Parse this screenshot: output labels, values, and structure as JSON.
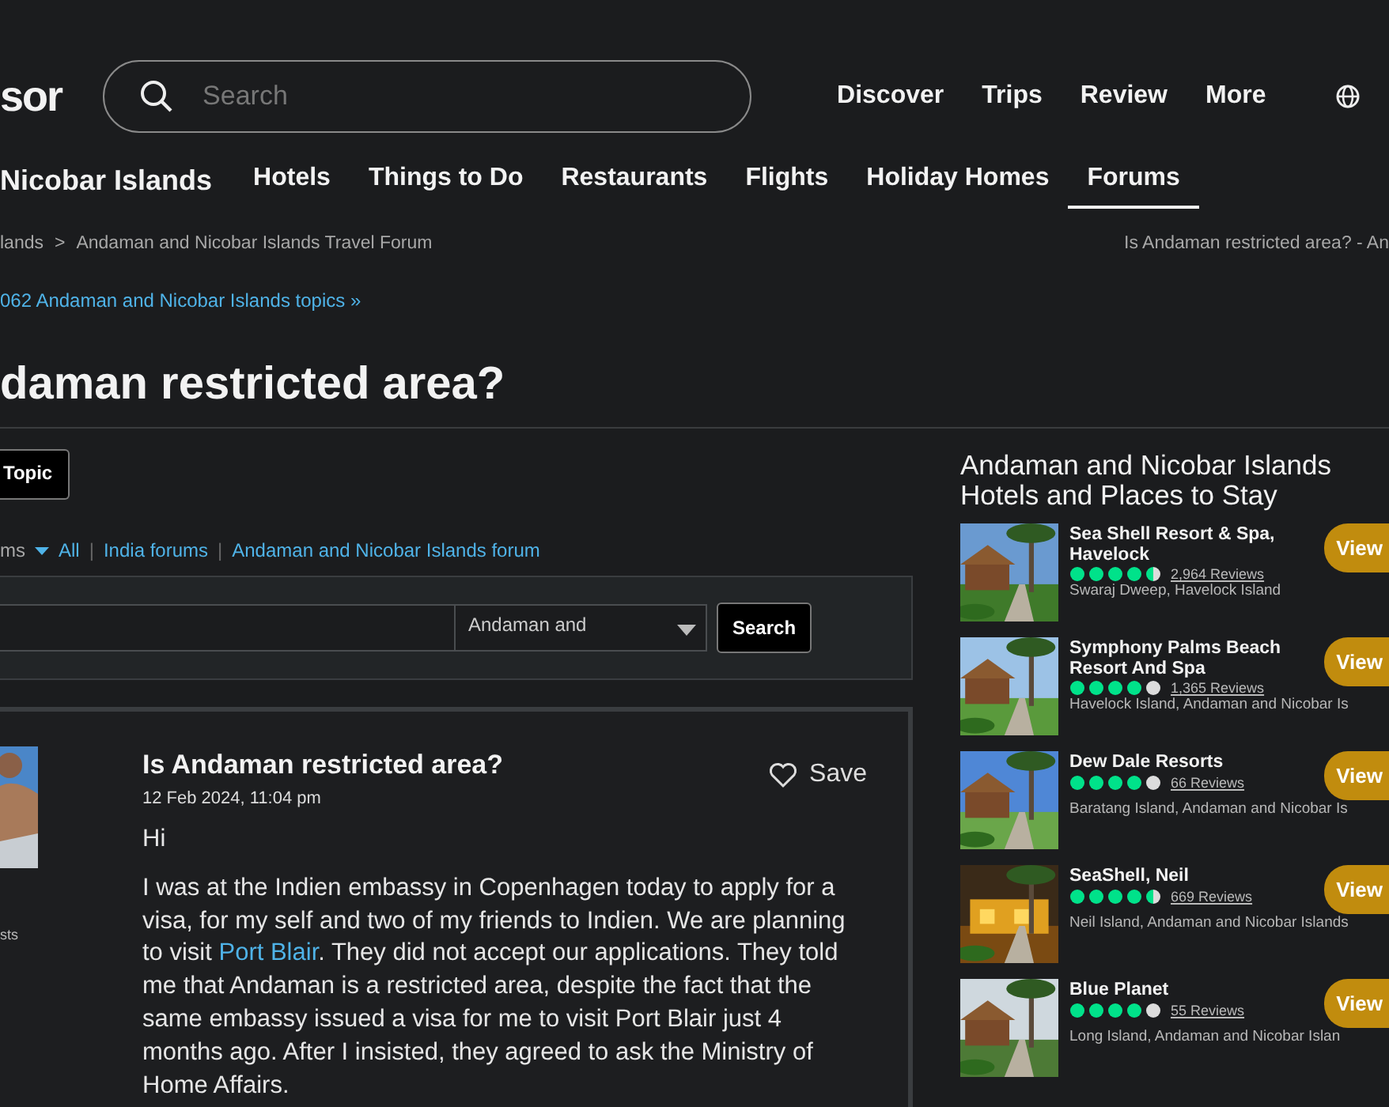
{
  "header": {
    "logo": "sor",
    "search": {
      "placeholder": "Search"
    },
    "nav": [
      "Discover",
      "Trips",
      "Review",
      "More"
    ]
  },
  "tabs": [
    {
      "label": "Nicobar Islands",
      "kind": "place",
      "selected": false
    },
    {
      "label": "Hotels",
      "kind": "tab",
      "selected": false
    },
    {
      "label": "Things to Do",
      "kind": "tab",
      "selected": false
    },
    {
      "label": "Restaurants",
      "kind": "tab",
      "selected": false
    },
    {
      "label": "Flights",
      "kind": "tab",
      "selected": false
    },
    {
      "label": "Holiday Homes",
      "kind": "tab",
      "selected": false
    },
    {
      "label": "Forums",
      "kind": "tab",
      "selected": true
    }
  ],
  "breadcrumb": {
    "items": [
      "lands",
      "Andaman and Nicobar Islands Travel Forum"
    ],
    "separator": ">",
    "current": "Is Andaman restricted area? - An"
  },
  "topics_link": "062 Andaman and Nicobar Islands topics »",
  "title": "daman restricted area?",
  "new_topic_button": "Topic",
  "forum_links": {
    "label": "ms",
    "separator": "|",
    "items": [
      "All",
      "India forums",
      "Andaman and Nicobar Islands forum"
    ]
  },
  "forum_search": {
    "scope": "Andaman and",
    "button": "Search"
  },
  "post": {
    "author_caption": "sts",
    "title": "Is Andaman restricted area?",
    "date": "12 Feb 2024, 11:04 pm",
    "save": "Save",
    "saved": false,
    "paragraphs": [
      [
        {
          "text": "Hi"
        }
      ],
      [
        {
          "text": "I was at the Indien embassy in Copenhagen today to apply for a visa, for my self and two of my friends to Indien. We are planning to visit "
        },
        {
          "text": "Port Blair",
          "link": true
        },
        {
          "text": ". They did not accept our applications. They told me that Andaman is a restricted area, despite the fact that the same embassy issued a visa for me to visit Port Blair just 4 months ago. After I insisted, they agreed to ask the Ministry of Home Affairs."
        }
      ]
    ]
  },
  "hotels": {
    "title": "Andaman and Nicobar Islands Hotels and Places to Stay",
    "items": [
      {
        "name": "Sea Shell Resort & Spa, Havelock",
        "stars": 4.5,
        "reviews": "2,964 Reviews",
        "location": "Swaraj Dweep, Havelock Island",
        "button": "View"
      },
      {
        "name": "Symphony Palms Beach Resort And Spa",
        "stars": 4,
        "reviews": "1,365 Reviews",
        "location": "Havelock Island, Andaman and Nicobar Is",
        "button": "View"
      },
      {
        "name": "Dew Dale Resorts",
        "stars": 4,
        "reviews": "66 Reviews",
        "location": "Baratang Island, Andaman and Nicobar Is",
        "button": "View"
      },
      {
        "name": "SeaShell, Neil",
        "stars": 4.5,
        "reviews": "669 Reviews",
        "location": "Neil Island, Andaman and Nicobar Islands",
        "button": "View"
      },
      {
        "name": "Blue Planet",
        "stars": 4,
        "reviews": "55 Reviews",
        "location": "Long Island, Andaman and Nicobar Islan",
        "button": "View"
      }
    ]
  }
}
